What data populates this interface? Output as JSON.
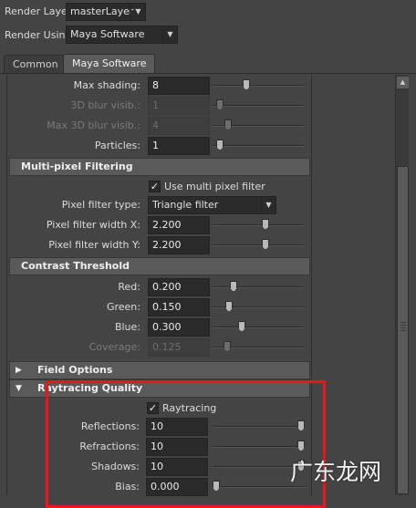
{
  "header": {
    "render_layer_label": "Render Layer",
    "render_layer_value": "masterLayer",
    "render_using_label": "Render Using",
    "render_using_value": "Maya Software"
  },
  "tabs": [
    {
      "label": "Common"
    },
    {
      "label": "Maya Software"
    }
  ],
  "motion_blur_rows": [
    {
      "label": "Max shading:",
      "value": "8",
      "enabled": true,
      "slider": 0.35
    },
    {
      "label": "3D blur visib.:",
      "value": "1",
      "enabled": false,
      "slider": 0.04
    },
    {
      "label": "Max 3D blur visib.:",
      "value": "4",
      "enabled": false,
      "slider": 0.14
    },
    {
      "label": "Particles:",
      "value": "1",
      "enabled": true,
      "slider": 0.04
    }
  ],
  "multipixel": {
    "title": "Multi-pixel Filtering",
    "use_filter_label": "Use multi pixel filter",
    "use_filter_checked": true,
    "filter_type_label": "Pixel filter type:",
    "filter_type_value": "Triangle filter",
    "width_x_label": "Pixel filter width X:",
    "width_x_value": "2.200",
    "width_x_slider": 0.58,
    "width_y_label": "Pixel filter width Y:",
    "width_y_value": "2.200",
    "width_y_slider": 0.58
  },
  "contrast": {
    "title": "Contrast Threshold",
    "rows": [
      {
        "label": "Red:",
        "value": "0.200",
        "enabled": true,
        "slider": 0.2
      },
      {
        "label": "Green:",
        "value": "0.150",
        "enabled": true,
        "slider": 0.15
      },
      {
        "label": "Blue:",
        "value": "0.300",
        "enabled": true,
        "slider": 0.3
      },
      {
        "label": "Coverage:",
        "value": "0.125",
        "enabled": false,
        "slider": 0.125
      }
    ]
  },
  "field_options": {
    "title": "Field Options",
    "expanded": false
  },
  "raytracing": {
    "title": "Raytracing Quality",
    "expanded": true,
    "raytracing_label": "Raytracing",
    "raytracing_checked": true,
    "rows": [
      {
        "label": "Reflections:",
        "value": "10",
        "slider": 1.0
      },
      {
        "label": "Refractions:",
        "value": "10",
        "slider": 1.0
      },
      {
        "label": "Shadows:",
        "value": "10",
        "slider": 1.0
      },
      {
        "label": "Bias:",
        "value": "0.000",
        "slider": 0.0
      }
    ]
  },
  "highlight_color": "#e8171b",
  "watermark": "广东龙网",
  "icons": {
    "dropdown": "chevron-down-icon",
    "collapsed": "triangle-right-icon",
    "expanded": "triangle-down-icon",
    "scroll_up": "arrow-up-icon",
    "grip": "grip-icon"
  }
}
